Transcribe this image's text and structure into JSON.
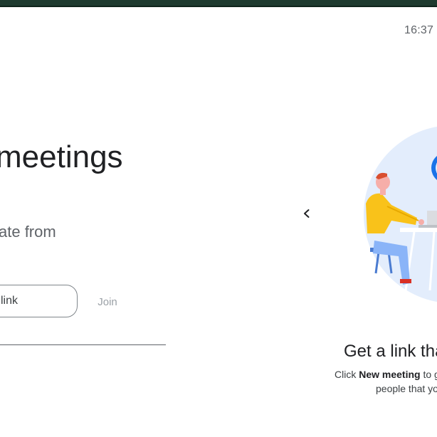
{
  "header": {
    "time": "16:37"
  },
  "hero": {
    "title_fragment": "meetings",
    "subtitle_fragment": "ate from"
  },
  "join": {
    "input_value_fragment": "link",
    "join_label": "Join"
  },
  "carousel": {
    "prev_icon": "chevron-left-icon",
    "slide_title": "Get a link tha",
    "slide_desc_prefix": "Click ",
    "slide_desc_bold": "New meeting",
    "slide_desc_suffix": " to g",
    "slide_desc_line2": "people that yo"
  },
  "colors": {
    "topbar": "#1e3a2f",
    "illustration_bg": "#e3edfc",
    "accent_blue": "#1a73e8",
    "shirt": "#f9c21a",
    "pants": "#8ab4f8"
  }
}
